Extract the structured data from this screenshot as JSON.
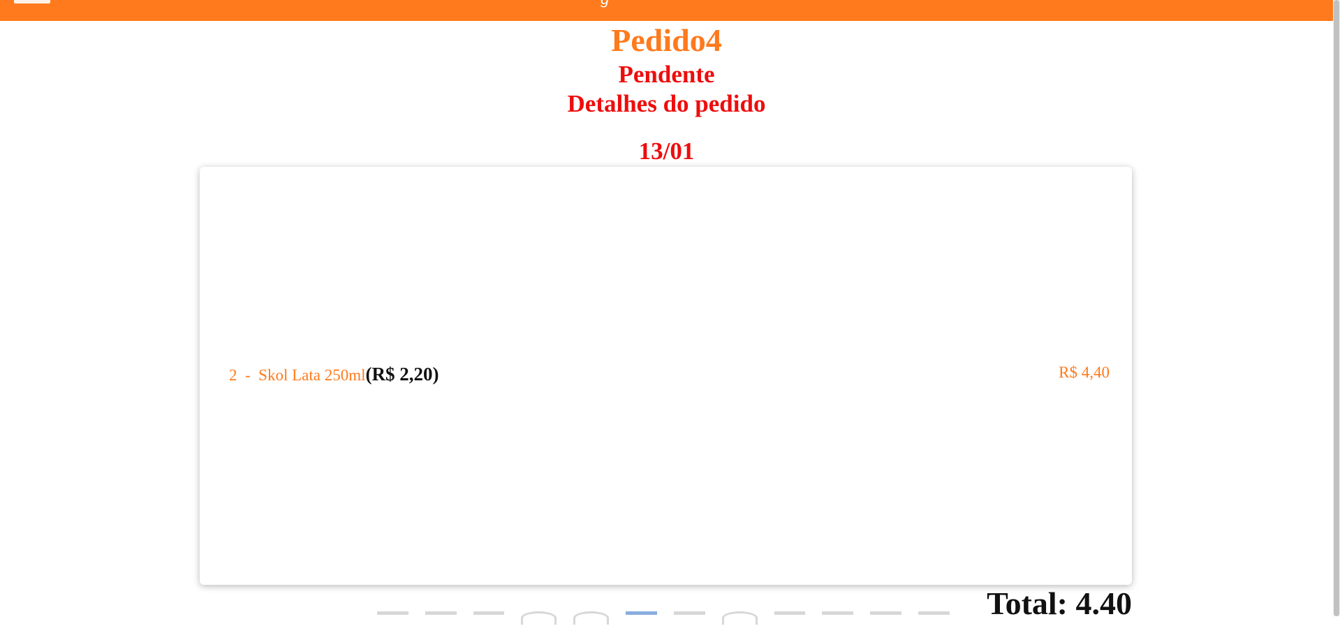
{
  "topbar": {
    "title": "g",
    "menu_icon": "menu-icon"
  },
  "order": {
    "title": "Pedido4",
    "status": "Pendente",
    "subtitle": "Detalhes do pedido",
    "date": "13/01"
  },
  "items": [
    {
      "quantity_name": "2  -  Skol Lata 250ml",
      "unit_price": "(R$ 2,20)",
      "line_total": "R$ 4,40"
    }
  ],
  "total_text": "Total: 4.40",
  "colors": {
    "accent": "#ff7a1c",
    "status": "#ee0d0d",
    "text": "#111111"
  },
  "footer_icons": [
    "app-icon",
    "app-icon",
    "app-icon",
    "app-icon",
    "app-icon",
    "app-icon",
    "app-icon",
    "app-icon",
    "app-icon",
    "app-icon",
    "app-icon",
    "app-icon"
  ]
}
